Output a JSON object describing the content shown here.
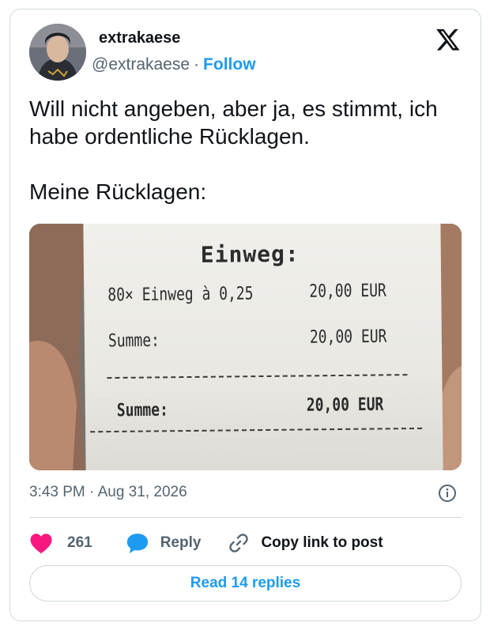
{
  "tweet": {
    "display_name": "extrakaese",
    "handle": "@extrakaese",
    "separator": "·",
    "follow_label": "Follow",
    "text_lines": [
      "Will nicht angeben, aber ja, es stimmt, ich habe ordentliche Rücklagen.",
      "Meine Rücklagen:"
    ],
    "timestamp": "3:43 PM · Aug 31, 2026"
  },
  "receipt": {
    "title": "Einweg:",
    "item_label": "80× Einweg à 0,25",
    "item_amount": "20,00 EUR",
    "sum_label": "Summe:",
    "sum_amount": "20,00 EUR",
    "total_label": "Summe:",
    "total_amount": "20,00 EUR"
  },
  "actions": {
    "like_count": "261",
    "reply_label": "Reply",
    "copy_label": "Copy link to post"
  },
  "read_replies_label": "Read 14 replies",
  "colors": {
    "accent": "#1d9bf0",
    "like": "#f91880",
    "text": "#0f1419",
    "muted": "#536471",
    "border": "#cfd9de"
  },
  "icons": [
    "x-logo-icon",
    "info-icon",
    "heart-icon",
    "reply-bubble-icon",
    "link-icon"
  ]
}
